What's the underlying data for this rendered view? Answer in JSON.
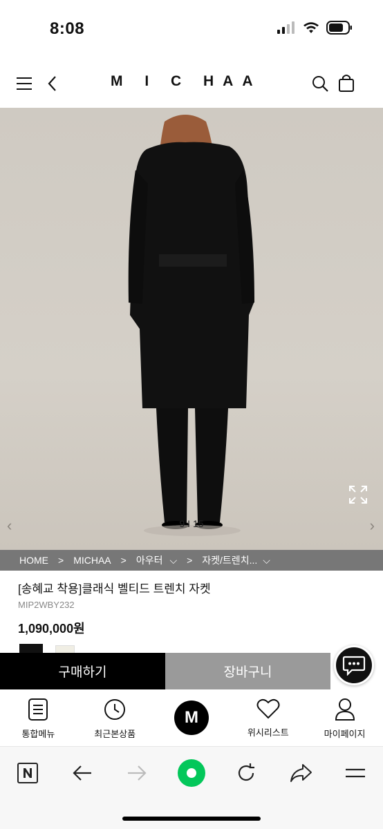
{
  "status_bar": {
    "time": "8:08"
  },
  "header": {
    "logo": "M I C HAA"
  },
  "hero": {
    "counter": "9 I 15"
  },
  "breadcrumb": {
    "items": [
      "HOME",
      ">",
      "MICHAA",
      ">",
      "아우터",
      "⌵",
      ">",
      "자켓/트렌치...",
      "⌵"
    ]
  },
  "product": {
    "title": "[송혜교 착용]클래식 벨티드 트렌치 자켓",
    "sku": "MIP2WBY232",
    "price": "1,090,000원"
  },
  "actions": {
    "buy_label": "구매하기",
    "cart_label": "장바구니"
  },
  "bottom_nav": [
    {
      "label": "통합메뉴",
      "icon": "menu-list-icon"
    },
    {
      "label": "최근본상품",
      "icon": "clock-icon"
    },
    {
      "label": "M",
      "icon": "home-m-icon"
    },
    {
      "label": "위시리스트",
      "icon": "heart-icon"
    },
    {
      "label": "마이페이지",
      "icon": "person-icon"
    }
  ],
  "browser": {
    "icons": [
      "naver-n-icon",
      "back-arrow-icon",
      "forward-arrow-icon",
      "green-home-icon",
      "reload-icon",
      "share-icon",
      "menu-icon"
    ]
  }
}
